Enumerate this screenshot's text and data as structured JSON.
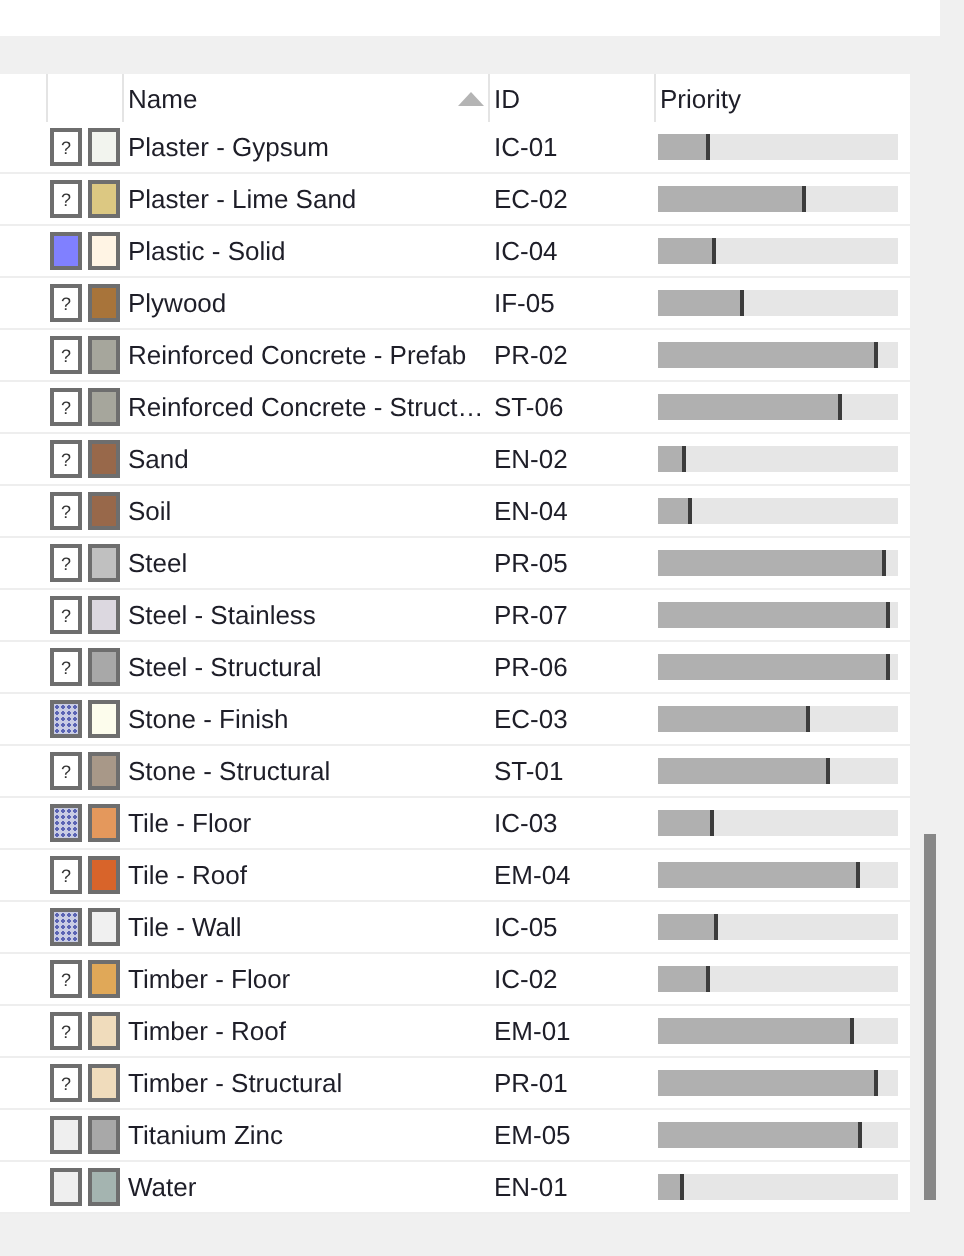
{
  "table": {
    "columns": [
      {
        "label": "Name",
        "sorted": true
      },
      {
        "label": "ID",
        "sorted": false
      },
      {
        "label": "Priority",
        "sorted": false
      }
    ],
    "rows": [
      {
        "marker": {
          "kind": "unknown",
          "glyph": "?"
        },
        "color": "#f2f4ee",
        "name": "Plaster - Gypsum",
        "id": "IC-01",
        "level": 0.22
      },
      {
        "marker": {
          "kind": "unknown",
          "glyph": "?"
        },
        "color": "#dcc882",
        "name": "Plaster - Lime Sand",
        "id": "EC-02",
        "level": 0.62
      },
      {
        "marker": {
          "kind": "color",
          "color": "#8080ff"
        },
        "color": "#fff4e4",
        "name": "Plastic - Solid",
        "id": "IC-04",
        "level": 0.24
      },
      {
        "marker": {
          "kind": "unknown",
          "glyph": "?"
        },
        "color": "#a8743a",
        "name": "Plywood",
        "id": "IF-05",
        "level": 0.36
      },
      {
        "marker": {
          "kind": "unknown",
          "glyph": "?"
        },
        "color": "#a6a69c",
        "name": "Reinforced Concrete - Prefab",
        "id": "PR-02",
        "level": 0.92
      },
      {
        "marker": {
          "kind": "unknown",
          "glyph": "?"
        },
        "color": "#a6a69c",
        "name": "Reinforced Concrete - Struct…",
        "id": "ST-06",
        "level": 0.77
      },
      {
        "marker": {
          "kind": "unknown",
          "glyph": "?"
        },
        "color": "#98684a",
        "name": "Sand",
        "id": "EN-02",
        "level": 0.12
      },
      {
        "marker": {
          "kind": "unknown",
          "glyph": "?"
        },
        "color": "#98684a",
        "name": "Soil",
        "id": "EN-04",
        "level": 0.14
      },
      {
        "marker": {
          "kind": "unknown",
          "glyph": "?"
        },
        "color": "#c0c0c0",
        "name": "Steel",
        "id": "PR-05",
        "level": 0.95
      },
      {
        "marker": {
          "kind": "unknown",
          "glyph": "?"
        },
        "color": "#dcd8e0",
        "name": "Steel - Stainless",
        "id": "PR-07",
        "level": 0.97
      },
      {
        "marker": {
          "kind": "unknown",
          "glyph": "?"
        },
        "color": "#a8a8a8",
        "name": "Steel - Structural",
        "id": "PR-06",
        "level": 0.97
      },
      {
        "marker": {
          "kind": "pattern"
        },
        "color": "#fcfcec",
        "name": "Stone - Finish",
        "id": "EC-03",
        "level": 0.63
      },
      {
        "marker": {
          "kind": "unknown",
          "glyph": "?"
        },
        "color": "#a89888",
        "name": "Stone - Structural",
        "id": "ST-01",
        "level": 0.72
      },
      {
        "marker": {
          "kind": "pattern"
        },
        "color": "#e4985c",
        "name": "Tile - Floor",
        "id": "IC-03",
        "level": 0.23
      },
      {
        "marker": {
          "kind": "unknown",
          "glyph": "?"
        },
        "color": "#d8642a",
        "name": "Tile - Roof",
        "id": "EM-04",
        "level": 0.84
      },
      {
        "marker": {
          "kind": "pattern"
        },
        "color": "#f0f0f0",
        "name": "Tile - Wall",
        "id": "IC-05",
        "level": 0.25
      },
      {
        "marker": {
          "kind": "unknown",
          "glyph": "?"
        },
        "color": "#e0a858",
        "name": "Timber - Floor",
        "id": "IC-02",
        "level": 0.22
      },
      {
        "marker": {
          "kind": "unknown",
          "glyph": "?"
        },
        "color": "#f0dcbc",
        "name": "Timber - Roof",
        "id": "EM-01",
        "level": 0.82
      },
      {
        "marker": {
          "kind": "unknown",
          "glyph": "?"
        },
        "color": "#f0dcbc",
        "name": "Timber - Structural",
        "id": "PR-01",
        "level": 0.92
      },
      {
        "marker": {
          "kind": "blank"
        },
        "color": "#a8a8a8",
        "name": "Titanium Zinc",
        "id": "EM-05",
        "level": 0.85
      },
      {
        "marker": {
          "kind": "blank"
        },
        "color": "#a4b4b0",
        "name": "Water",
        "id": "EN-01",
        "level": 0.11
      }
    ]
  }
}
